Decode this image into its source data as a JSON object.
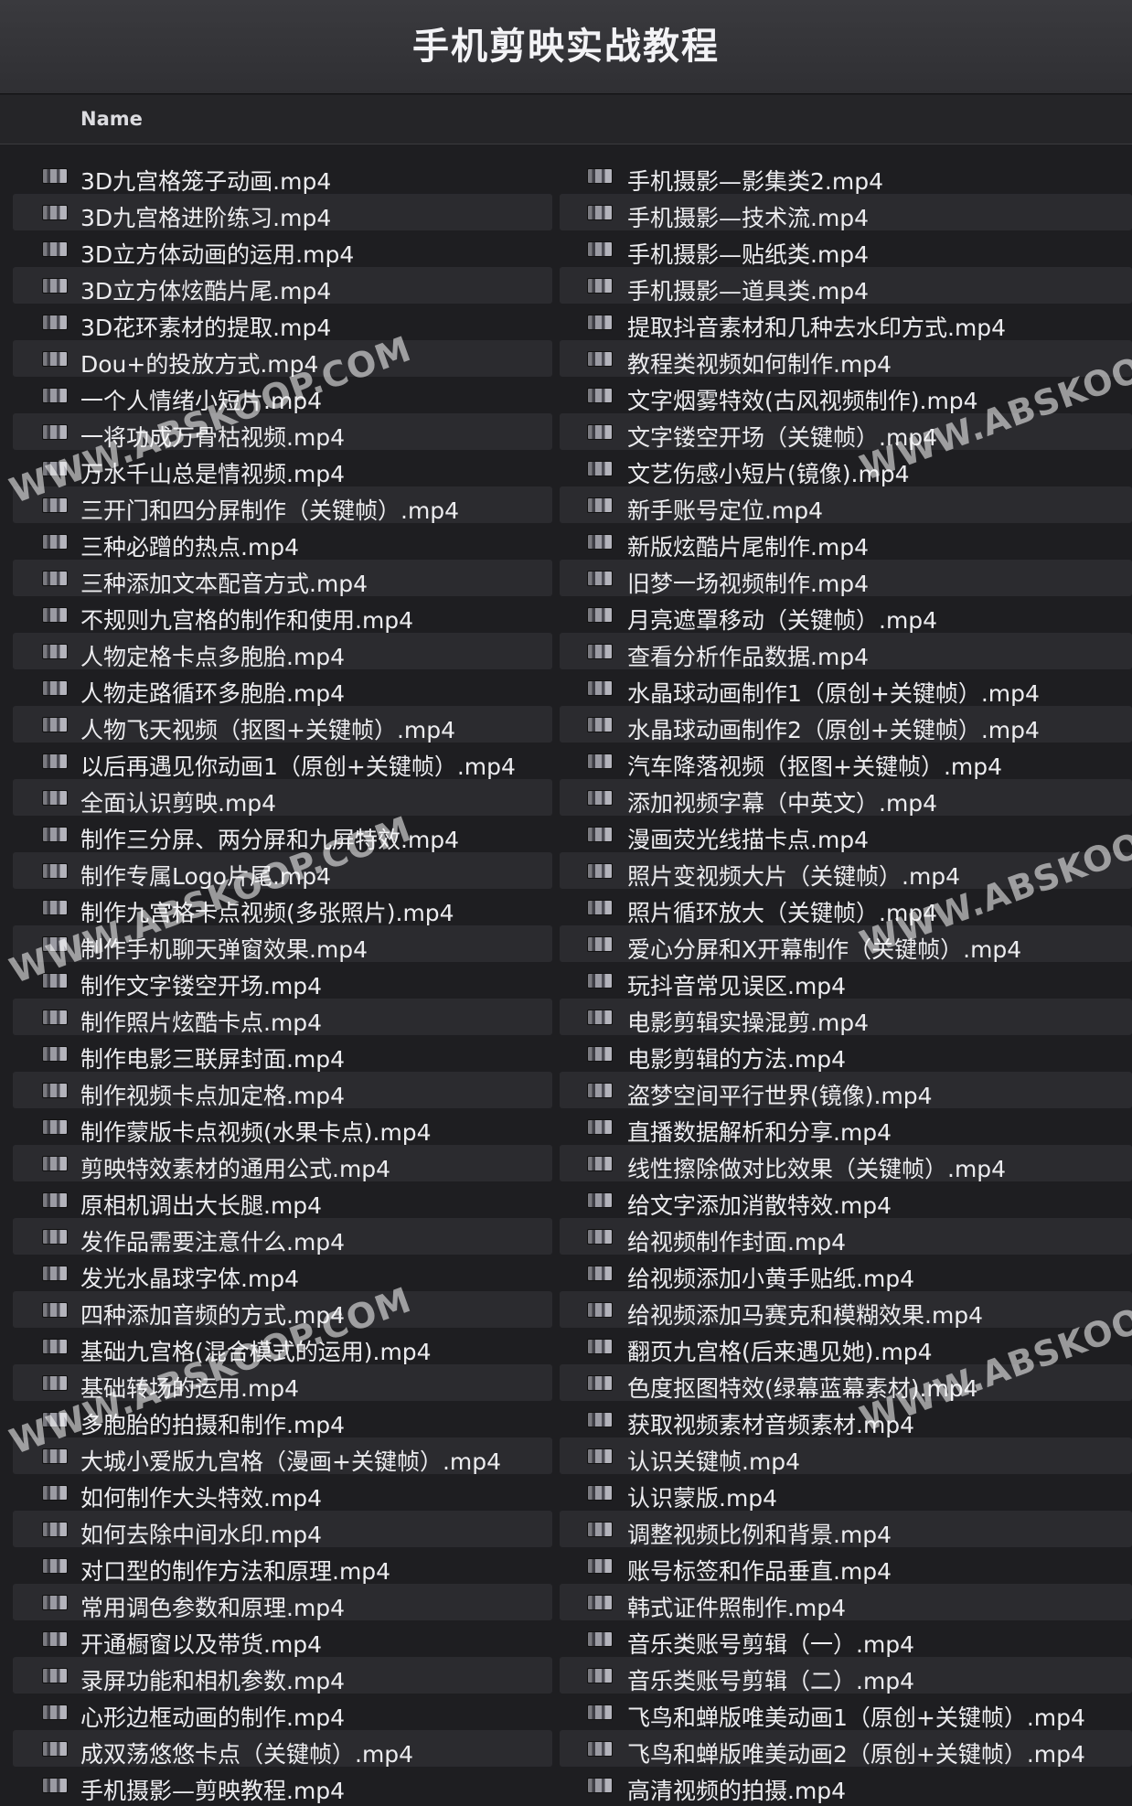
{
  "window": {
    "title": "手机剪映实战教程"
  },
  "header": {
    "name_column": "Name"
  },
  "left_files": [
    "3D九宫格笼子动画.mp4",
    "3D九宫格进阶练习.mp4",
    "3D立方体动画的运用.mp4",
    "3D立方体炫酷片尾.mp4",
    "3D花环素材的提取.mp4",
    "Dou+的投放方式.mp4",
    "一个人情绪小短片.mp4",
    "一将功成万骨枯视频.mp4",
    "万水千山总是情视频.mp4",
    "三开门和四分屏制作（关键帧）.mp4",
    "三种必蹭的热点.mp4",
    "三种添加文本配音方式.mp4",
    "不规则九宫格的制作和使用.mp4",
    "人物定格卡点多胞胎.mp4",
    "人物走路循环多胞胎.mp4",
    "人物飞天视频（抠图+关键帧）.mp4",
    "以后再遇见你动画1（原创+关键帧）.mp4",
    "全面认识剪映.mp4",
    "制作三分屏、两分屏和九屏特效.mp4",
    "制作专属Logo片尾.mp4",
    "制作九宫格卡点视频(多张照片).mp4",
    "制作手机聊天弹窗效果.mp4",
    "制作文字镂空开场.mp4",
    "制作照片炫酷卡点.mp4",
    "制作电影三联屏封面.mp4",
    "制作视频卡点加定格.mp4",
    "制作蒙版卡点视频(水果卡点).mp4",
    "剪映特效素材的通用公式.mp4",
    "原相机调出大长腿.mp4",
    "发作品需要注意什么.mp4",
    "发光水晶球字体.mp4",
    "四种添加音频的方式.mp4",
    "基础九宫格(混合模式的运用).mp4",
    "基础转场的运用.mp4",
    "多胞胎的拍摄和制作.mp4",
    "大城小爱版九宫格（漫画+关键帧）.mp4",
    "如何制作大头特效.mp4",
    "如何去除中间水印.mp4",
    "对口型的制作方法和原理.mp4",
    "常用调色参数和原理.mp4",
    "开通橱窗以及带货.mp4",
    "录屏功能和相机参数.mp4",
    "心形边框动画的制作.mp4",
    "成双荡悠悠卡点（关键帧）.mp4",
    "手机摄影—剪映教程.mp4"
  ],
  "right_files": [
    "手机摄影—影集类2.mp4",
    "手机摄影—技术流.mp4",
    "手机摄影—贴纸类.mp4",
    "手机摄影—道具类.mp4",
    "提取抖音素材和几种去水印方式.mp4",
    "教程类视频如何制作.mp4",
    "文字烟雾特效(古风视频制作).mp4",
    "文字镂空开场（关键帧）.mp4",
    "文艺伤感小短片(镜像).mp4",
    "新手账号定位.mp4",
    "新版炫酷片尾制作.mp4",
    "旧梦一场视频制作.mp4",
    "月亮遮罩移动（关键帧）.mp4",
    "查看分析作品数据.mp4",
    "水晶球动画制作1（原创+关键帧）.mp4",
    "水晶球动画制作2（原创+关键帧）.mp4",
    "汽车降落视频（抠图+关键帧）.mp4",
    "添加视频字幕（中英文）.mp4",
    "漫画荧光线描卡点.mp4",
    "照片变视频大片（关键帧）.mp4",
    "照片循环放大（关键帧）.mp4",
    "爱心分屏和X开幕制作（关键帧）.mp4",
    "玩抖音常见误区.mp4",
    "电影剪辑实操混剪.mp4",
    "电影剪辑的方法.mp4",
    "盗梦空间平行世界(镜像).mp4",
    "直播数据解析和分享.mp4",
    "线性擦除做对比效果（关键帧）.mp4",
    "给文字添加消散特效.mp4",
    "给视频制作封面.mp4",
    "给视频添加小黄手贴纸.mp4",
    "给视频添加马赛克和模糊效果.mp4",
    "翻页九宫格(后来遇见她).mp4",
    "色度抠图特效(绿幕蓝幕素材).mp4",
    "获取视频素材音频素材.mp4",
    "认识关键帧.mp4",
    "认识蒙版.mp4",
    "调整视频比例和背景.mp4",
    "账号标签和作品垂直.mp4",
    "韩式证件照制作.mp4",
    "音乐类账号剪辑（一）.mp4",
    "音乐类账号剪辑（二）.mp4",
    "飞鸟和蝉版唯美动画1（原创+关键帧）.mp4",
    "飞鸟和蝉版唯美动画2（原创+关键帧）.mp4",
    "高清视频的拍摄.mp4"
  ],
  "watermarks": [
    "WWW.ABSKOOP.COM",
    "WWW.ABSKOOP.COM",
    "WWW.ABSKOOP.COM",
    "WWW.ABSKOOP.COM",
    "WWW.ABSKOOP.COM",
    "WWW.ABSKOOP.COM"
  ]
}
